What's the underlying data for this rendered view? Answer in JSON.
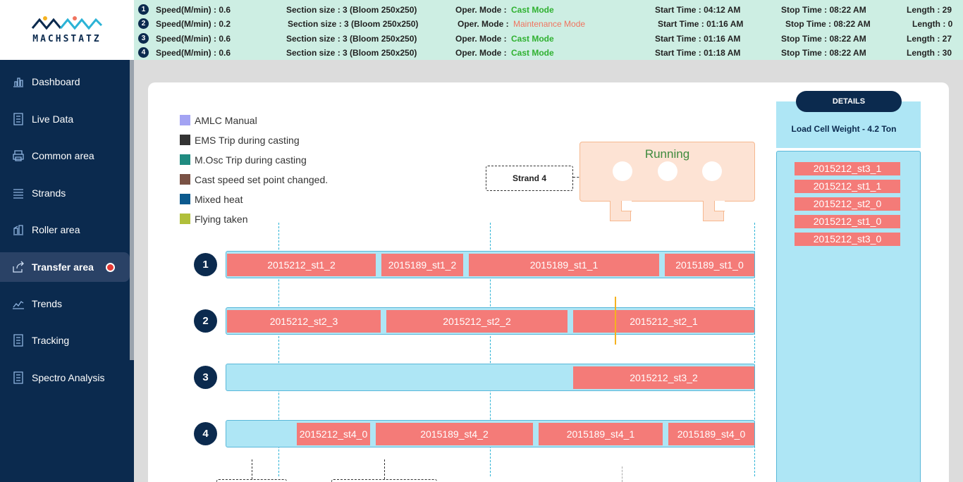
{
  "app": {
    "logo_text": "MACHSTATZ"
  },
  "sidebar": {
    "items": [
      {
        "label": "Dashboard",
        "icon": "bar-chart-icon"
      },
      {
        "label": "Live Data",
        "icon": "document-icon"
      },
      {
        "label": "Common area",
        "icon": "printer-icon"
      },
      {
        "label": "Strands",
        "icon": "menu-lines-icon"
      },
      {
        "label": "Roller area",
        "icon": "roller-icon"
      },
      {
        "label": "Transfer area",
        "icon": "share-icon",
        "active": true
      },
      {
        "label": "Trends",
        "icon": "trend-line-icon"
      },
      {
        "label": "Tracking",
        "icon": "document-icon"
      },
      {
        "label": "Spectro Analysis",
        "icon": "document-icon"
      }
    ]
  },
  "status_rows": [
    {
      "num": "1",
      "speed": "Speed(M/min) : 0.6",
      "section": "Section size : 3 (Bloom 250x250)",
      "mode_label": "Oper. Mode :",
      "mode": "Cast Mode",
      "start": "Start Time : 04:12 AM",
      "stop": "Stop Time : 08:22 AM",
      "length": "Length : 29"
    },
    {
      "num": "2",
      "speed": "Speed(M/min) : 0.2",
      "section": "Section size : 3 (Bloom 250x250)",
      "mode_label": "Oper. Mode :",
      "mode": "Maintenance Mode",
      "start": "Start Time : 01:16 AM",
      "stop": "Stop Time : 08:22 AM",
      "length": "Length : 0"
    },
    {
      "num": "3",
      "speed": "Speed(M/min) : 0.6",
      "section": "Section size : 3 (Bloom 250x250)",
      "mode_label": "Oper. Mode :",
      "mode": "Cast Mode",
      "start": "Start Time : 01:16 AM",
      "stop": "Stop Time : 08:22 AM",
      "length": "Length : 27"
    },
    {
      "num": "4",
      "speed": "Speed(M/min) : 0.6",
      "section": "Section size : 3 (Bloom 250x250)",
      "mode_label": "Oper. Mode :",
      "mode": "Cast Mode",
      "start": "Start Time : 01:18 AM",
      "stop": "Stop Time : 08:22 AM",
      "length": "Length : 30"
    }
  ],
  "colors": {
    "cast_mode": "#2fb130",
    "maintenance_mode": "#f0745f",
    "segment": "#f47b78",
    "track": "#aee6f5",
    "navy": "#0b2a4e"
  },
  "legend": [
    {
      "label": "AMLC Manual",
      "color": "#a3a3f3"
    },
    {
      "label": "EMS Trip during casting",
      "color": "#333333"
    },
    {
      "label": "M.Osc Trip during casting",
      "color": "#208b80"
    },
    {
      "label": "Cast speed set point changed.",
      "color": "#7a5245"
    },
    {
      "label": "Mixed heat",
      "color": "#0c5a8e"
    },
    {
      "label": "Flying taken",
      "color": "#b0bf3a"
    }
  ],
  "machine": {
    "strand_label": "Strand 4",
    "status": "Running"
  },
  "strands": [
    {
      "num": "1",
      "segments": [
        "2015212_st1_2",
        "2015189_st1_2",
        "2015189_st1_1",
        "2015189_st1_0"
      ]
    },
    {
      "num": "2",
      "segments": [
        "2015212_st2_3",
        "2015212_st2_2",
        "2015212_st2_1"
      ]
    },
    {
      "num": "3",
      "segments": [
        "2015212_st3_2"
      ]
    },
    {
      "num": "4",
      "segments": [
        "2015212_st4_0",
        "2015189_st4_2",
        "2015189_st4_1",
        "2015189_st4_0"
      ]
    }
  ],
  "details": {
    "title": "DETAILS",
    "weight": "Load Cell Weight - 4.2 Ton",
    "items": [
      "2015212_st3_1",
      "2015212_st1_1",
      "2015212_st2_0",
      "2015212_st1_0",
      "2015212_st3_0"
    ]
  }
}
